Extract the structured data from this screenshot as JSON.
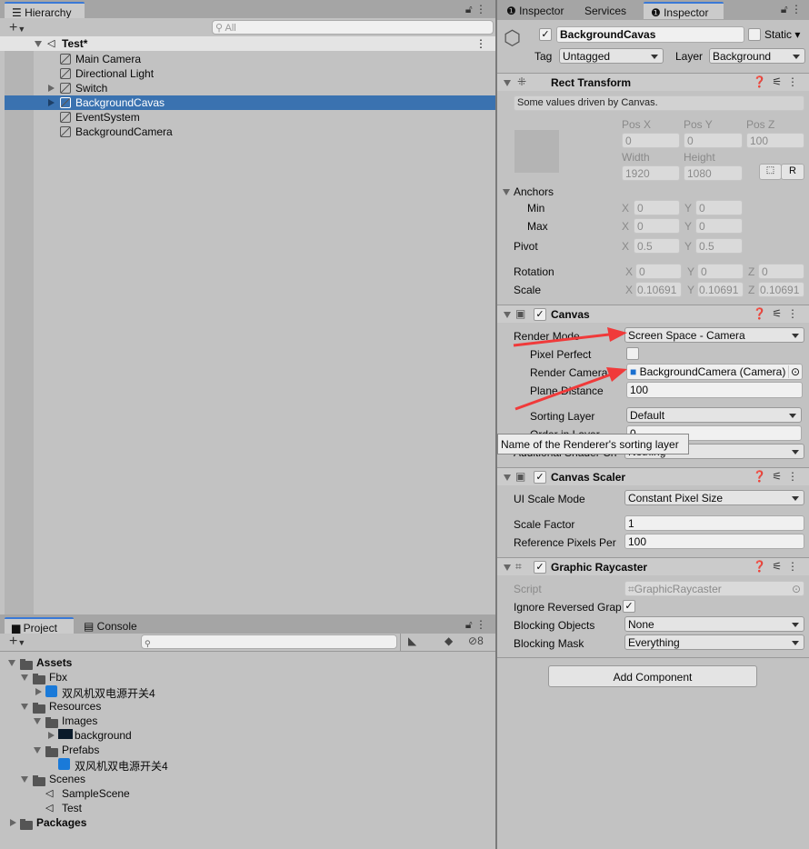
{
  "hierarchy": {
    "tab": "Hierarchy",
    "search_placeholder": "All",
    "scene": "Test*",
    "items": [
      {
        "label": "Main Camera",
        "expandable": false,
        "selected": false
      },
      {
        "label": "Directional Light",
        "expandable": false,
        "selected": false
      },
      {
        "label": "Switch",
        "expandable": true,
        "selected": false
      },
      {
        "label": "BackgroundCavas",
        "expandable": true,
        "selected": true
      },
      {
        "label": "EventSystem",
        "expandable": false,
        "selected": false
      },
      {
        "label": "BackgroundCamera",
        "expandable": false,
        "selected": false
      }
    ]
  },
  "project": {
    "tabs": [
      "Project",
      "Console"
    ],
    "hidden_count": "8",
    "tree": [
      {
        "label": "Assets",
        "depth": 0,
        "icon": "folder",
        "arrow": "open",
        "bold": true
      },
      {
        "label": "Fbx",
        "depth": 1,
        "icon": "folder",
        "arrow": "open"
      },
      {
        "label": "双风机双电源开关4",
        "depth": 2,
        "icon": "model",
        "arrow": "closed"
      },
      {
        "label": "Resources",
        "depth": 1,
        "icon": "folder",
        "arrow": "open"
      },
      {
        "label": "Images",
        "depth": 2,
        "icon": "folder",
        "arrow": "open"
      },
      {
        "label": "background",
        "depth": 3,
        "icon": "texture",
        "arrow": "closed"
      },
      {
        "label": "Prefabs",
        "depth": 2,
        "icon": "folder",
        "arrow": "open"
      },
      {
        "label": "双风机双电源开关4",
        "depth": 3,
        "icon": "prefab",
        "arrow": "none"
      },
      {
        "label": "Scenes",
        "depth": 1,
        "icon": "folder",
        "arrow": "open"
      },
      {
        "label": "SampleScene",
        "depth": 2,
        "icon": "scene",
        "arrow": "none"
      },
      {
        "label": "Test",
        "depth": 2,
        "icon": "scene",
        "arrow": "none"
      },
      {
        "label": "Packages",
        "depth": 0,
        "icon": "folder",
        "arrow": "closed",
        "bold": true
      }
    ]
  },
  "inspector": {
    "tabs": [
      "Inspector",
      "Services",
      "Inspector"
    ],
    "object_name": "BackgroundCavas",
    "active": true,
    "static_label": "Static",
    "tag_label": "Tag",
    "tag": "Untagged",
    "layer_label": "Layer",
    "layer": "Background",
    "rect": {
      "title": "Rect Transform",
      "note": "Some values driven by Canvas.",
      "pos_x_label": "Pos X",
      "pos_y_label": "Pos Y",
      "pos_z_label": "Pos Z",
      "pos_x": "0",
      "pos_y": "0",
      "pos_z": "100",
      "width_label": "Width",
      "height_label": "Height",
      "width": "1920",
      "height": "1080",
      "raw_button": "R",
      "anchors_label": "Anchors",
      "min_label": "Min",
      "min_x": "0",
      "min_y": "0",
      "max_label": "Max",
      "max_x": "0",
      "max_y": "0",
      "pivot_label": "Pivot",
      "pivot_x": "0.5",
      "pivot_y": "0.5",
      "rotation_label": "Rotation",
      "rot_x": "0",
      "rot_y": "0",
      "rot_z": "0",
      "scale_label": "Scale",
      "scale_x": "0.10691",
      "scale_y": "0.10691",
      "scale_z": "0.10691",
      "x": "X",
      "y": "Y",
      "z": "Z"
    },
    "canvas": {
      "title": "Canvas",
      "enabled": true,
      "render_mode_label": "Render Mode",
      "render_mode": "Screen Space - Camera",
      "pixel_perfect_label": "Pixel Perfect",
      "pixel_perfect": false,
      "render_camera_label": "Render Camera",
      "render_camera": "BackgroundCamera (Camera)",
      "plane_distance_label": "Plane Distance",
      "plane_distance": "100",
      "sorting_layer_label": "Sorting Layer",
      "sorting_layer": "Default",
      "order_label": "Order in Layer",
      "order": "0",
      "shader_label": "Additional Shader Ch",
      "shader": "Nothing",
      "tooltip": "Name of the Renderer's sorting layer"
    },
    "scaler": {
      "title": "Canvas Scaler",
      "enabled": true,
      "mode_label": "UI Scale Mode",
      "mode": "Constant Pixel Size",
      "factor_label": "Scale Factor",
      "factor": "1",
      "ref_label": "Reference Pixels Per",
      "ref": "100"
    },
    "raycaster": {
      "title": "Graphic Raycaster",
      "enabled": true,
      "script_label": "Script",
      "script": "GraphicRaycaster",
      "ignore_label": "Ignore Reversed Grap",
      "ignore": true,
      "blocking_objects_label": "Blocking Objects",
      "blocking_objects": "None",
      "blocking_mask_label": "Blocking Mask",
      "blocking_mask": "Everything"
    },
    "add_component": "Add Component"
  },
  "colors": {
    "selection": "#3a72b0",
    "accent": "#3a79d6",
    "annotation_arrow": "#f03a3a"
  }
}
